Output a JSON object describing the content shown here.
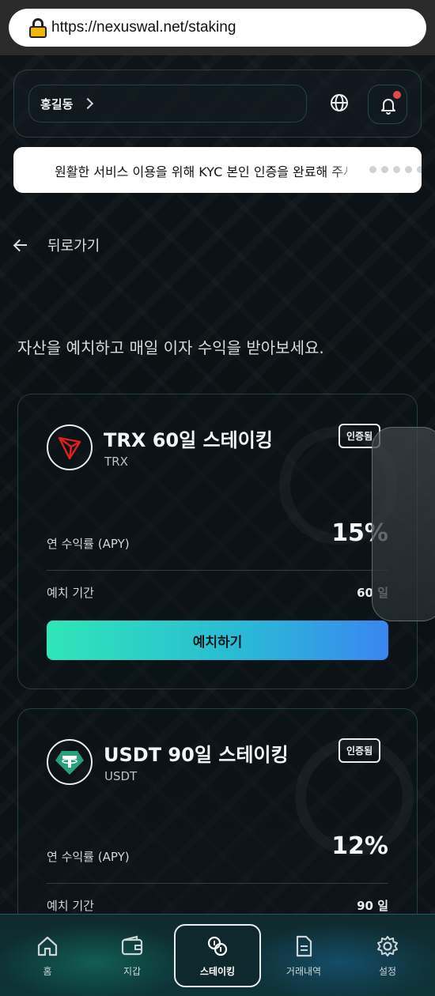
{
  "browser": {
    "url": "https://nexuswal.net/staking"
  },
  "header": {
    "user_name": "홍길동"
  },
  "notice": {
    "text": "원활한 서비스 이용을 위해 KYC 본인 인증을 완료해 주세요"
  },
  "page": {
    "back_label": "뒤로가기",
    "subtitle": "자산을 예치하고 매일 이자 수익을 받아보세요."
  },
  "cards": [
    {
      "title": "TRX 60일 스테이킹",
      "symbol": "TRX",
      "badge": "인증됨",
      "apy_label": "연 수익률 (APY)",
      "apy_value": "15%",
      "period_label": "예치 기간",
      "period_value": "60 일",
      "button": "예치하기",
      "icon": "tron-icon",
      "icon_color": "#e0201f"
    },
    {
      "title": "USDT 90일 스테이킹",
      "symbol": "USDT",
      "badge": "인증됨",
      "apy_label": "연 수익률 (APY)",
      "apy_value": "12%",
      "period_label": "예치 기간",
      "period_value": "90 일",
      "icon": "tether-icon",
      "icon_color": "#26a17b"
    }
  ],
  "nav": {
    "items": [
      {
        "label": "홈",
        "icon": "home-icon"
      },
      {
        "label": "지갑",
        "icon": "wallet-icon"
      },
      {
        "label": "스테이킹",
        "icon": "coins-icon",
        "active": true
      },
      {
        "label": "거래내역",
        "icon": "document-icon"
      },
      {
        "label": "설정",
        "icon": "gear-icon"
      }
    ]
  },
  "colors": {
    "accent_start": "#2ee6b6",
    "accent_end": "#3a86f0",
    "alert_dot": "#e04a4a"
  }
}
